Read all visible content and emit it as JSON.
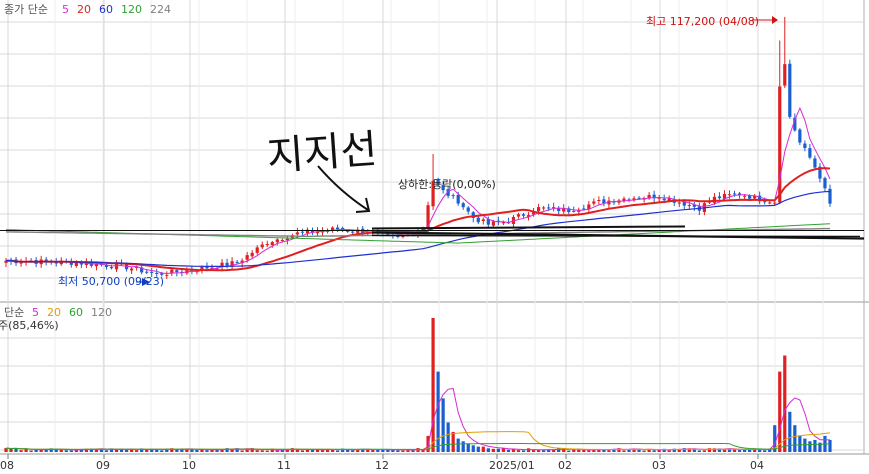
{
  "legend_top": {
    "prefix": "종가 단순",
    "items": [
      {
        "text": "5",
        "color": "#d62ad6"
      },
      {
        "text": "20",
        "color": "#e02020"
      },
      {
        "text": "60",
        "color": "#2030d0"
      },
      {
        "text": "120",
        "color": "#30a030"
      },
      {
        "text": "224",
        "color": "#808080"
      }
    ]
  },
  "legend_bottom": {
    "prefix": "단순",
    "items": [
      {
        "text": "5",
        "color": "#d62ad6"
      },
      {
        "text": "20",
        "color": "#e0a000"
      },
      {
        "text": "60",
        "color": "#30a030"
      },
      {
        "text": "120",
        "color": "#808080"
      }
    ],
    "line2": "주(85,46%)"
  },
  "annotations": {
    "high": "최고 117,200 (04/08)",
    "low": "최저 50,700 (09/23)",
    "ud": "상하한:등락(0,00%)",
    "handwritten": "지지선"
  },
  "colors": {
    "up": "#e02020",
    "down": "#1a5fd0",
    "ma5": "#d62ad6",
    "ma20": "#e02020",
    "ma60": "#2030d0",
    "ma120": "#30a030",
    "ma224": "#808080",
    "vma20": "#e0a000",
    "grid": "#d8d8d8",
    "ink": "#111111"
  },
  "chart_data": {
    "type": "candlestick",
    "x_axis": {
      "tick_labels": [
        "08",
        "09",
        "10",
        "11",
        "12",
        "2025/01",
        "02",
        "03",
        "04"
      ]
    },
    "price_range": [
      44000,
      122000
    ],
    "high": {
      "value": 117200,
      "date": "04/08"
    },
    "low": {
      "value": 50700,
      "date": "09/23"
    },
    "support_line_price": 61500,
    "volume_max_index": 100
  }
}
